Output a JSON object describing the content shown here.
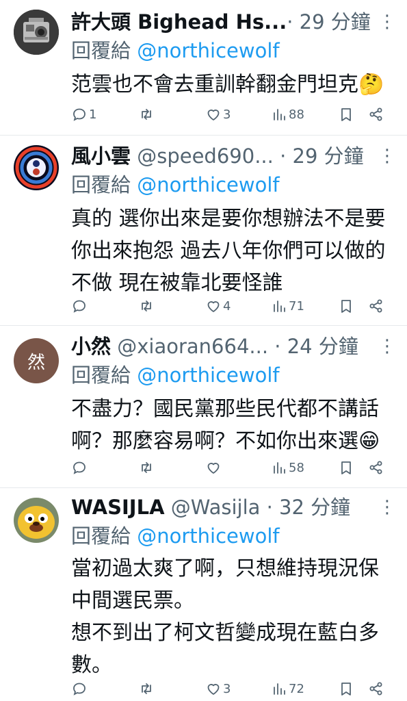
{
  "colors": {
    "text": "#0f1419",
    "secondary": "#536471",
    "accent": "#1d9bf0"
  },
  "tweets": [
    {
      "name": "許大頭 Bighead Hs...",
      "handle": "",
      "time": "· 29 分鐘",
      "reply_prefix": "回覆給 ",
      "reply_to": "@northicewolf",
      "text": "范雲也不會去重訓幹翻金門坦克🤔",
      "replies": "1",
      "retweets": "",
      "likes": "3",
      "views": "88",
      "avatar_icon": "camera-machine-avatar"
    },
    {
      "name": "風小雲",
      "handle": " @speed690...",
      "time": " · 29 分鐘",
      "reply_prefix": "回覆給 ",
      "reply_to": "@northicewolf",
      "text": "真的  選你出來是要你想辦法不是要\n你出來抱怨  過去八年你們可以做的\n不做 現在被靠北要怪誰",
      "replies": "",
      "retweets": "",
      "likes": "4",
      "views": "71",
      "avatar_icon": "orb-avatar"
    },
    {
      "name": "小然",
      "handle": " @xiaoran664...",
      "time": " · 24 分鐘",
      "reply_prefix": "回覆給 ",
      "reply_to": "@northicewolf",
      "text": "不盡力？國民黨那些民代都不講話\n啊？那麼容易啊？不如你出來選😁",
      "replies": "",
      "retweets": "",
      "likes": "",
      "views": "58",
      "avatar_letter": "然"
    },
    {
      "name": "WASIJLA",
      "handle": " @Wasijla",
      "time": " · 32 分鐘",
      "reply_prefix": "回覆給 ",
      "reply_to": "@northicewolf",
      "text": "當初過太爽了啊，只想維持現況保\n中間選民票。\n想不到出了柯文哲變成現在藍白多\n數。",
      "replies": "",
      "retweets": "",
      "likes": "3",
      "views": "72",
      "avatar_icon": "cartoon-dog-avatar"
    }
  ],
  "more_icon": "⋮"
}
